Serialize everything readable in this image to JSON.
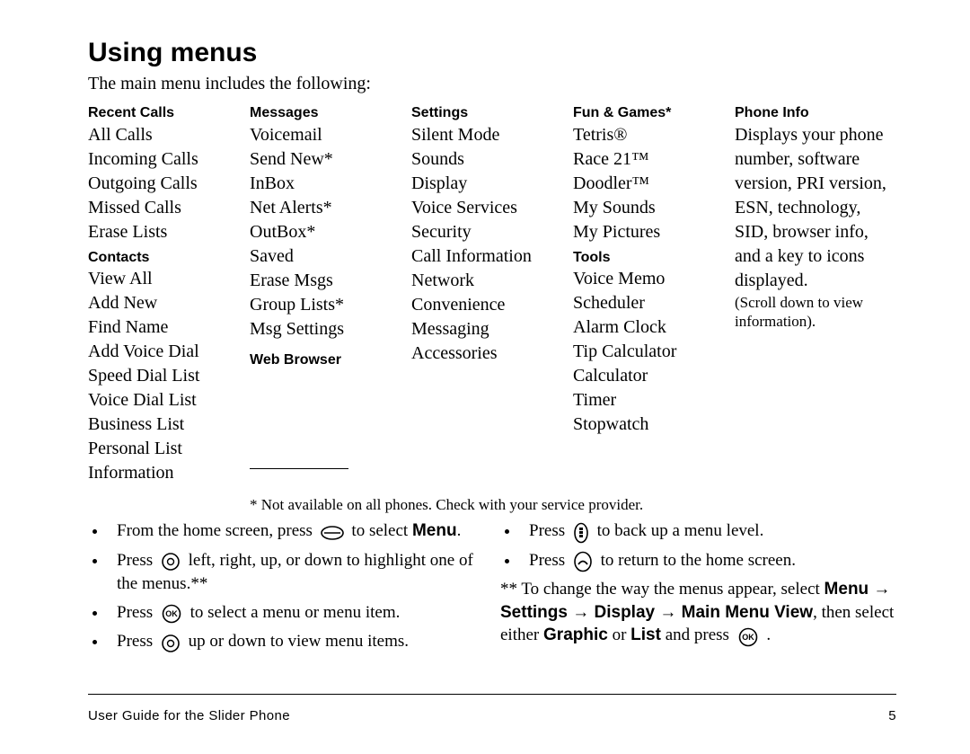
{
  "heading": "Using menus",
  "intro": "The main menu includes the following:",
  "columns": {
    "c1": {
      "cat1": "Recent Calls",
      "i1": [
        "All Calls",
        "Incoming Calls",
        "Outgoing Calls",
        "Missed Calls",
        "Erase Lists"
      ],
      "cat2": "Contacts",
      "i2": [
        "View All",
        "Add New",
        "Find Name",
        "Add Voice Dial",
        "Speed Dial List",
        "Voice Dial List",
        "Business List",
        "Personal List",
        "Information"
      ]
    },
    "c2": {
      "cat1": "Messages",
      "i1": [
        "Voicemail",
        "Send New*",
        "InBox",
        "Net Alerts*",
        "OutBox*",
        "Saved",
        "Erase Msgs",
        "Group Lists*",
        "Msg Settings"
      ],
      "cat2": "Web Browser"
    },
    "c3": {
      "cat1": "Settings",
      "i1": [
        "Silent Mode",
        "Sounds",
        "Display",
        "Voice Services",
        "Security",
        "Call Information",
        "Network",
        "Convenience",
        "Messaging",
        "Accessories"
      ]
    },
    "c4": {
      "cat1": "Fun & Games*",
      "i1": [
        "Tetris®",
        "Race 21™",
        "Doodler™",
        "My Sounds",
        "My Pictures"
      ],
      "cat2": "Tools",
      "i2": [
        "Voice Memo",
        "Scheduler",
        "Alarm Clock",
        "Tip Calculator",
        "Calculator",
        "Timer",
        "Stopwatch"
      ]
    },
    "c5": {
      "cat1": "Phone Info",
      "desc": [
        "Displays your phone",
        "number, software",
        "version, PRI version,",
        "ESN, technology,",
        "SID, browser info,",
        "and a key to icons",
        "displayed."
      ],
      "note": [
        "(Scroll down to view",
        "information)."
      ]
    }
  },
  "star_note": "* Not available on all phones. Check with your service provider.",
  "bullets_left": {
    "b1a": "From the home screen, press ",
    "b1b": " to select ",
    "b1c_bold": "Menu",
    "b1d": ".",
    "b2a": "Press ",
    "b2b": " left, right, up, or down to highlight one of the menus.**",
    "b3a": "Press ",
    "b3b": " to select a menu or menu item.",
    "b4a": "Press ",
    "b4b": " up or down to view menu items."
  },
  "bullets_right": {
    "b1a": "Press ",
    "b1b": " to back up a menu level.",
    "b2a": "Press ",
    "b2b": " to return to the home screen.",
    "star_a": "** To change the way the menus appear, select ",
    "star_b_bold": "Menu",
    "star_c_bold": " → Settings → Display → Main Menu View",
    "star_d": ", then select either ",
    "star_e_bold": "Graphic",
    "star_f": " or ",
    "star_g_bold": "List",
    "star_h": " and press ",
    "star_i": " ."
  },
  "footer_left": "User Guide for the Slider Phone",
  "footer_right": "5"
}
